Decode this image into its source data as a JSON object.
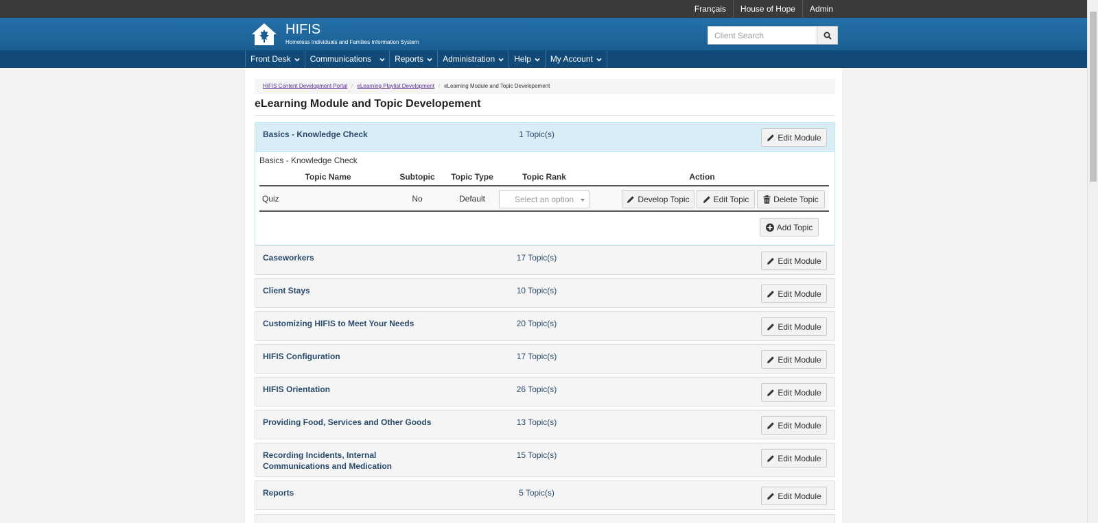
{
  "topbar": {
    "language": "Français",
    "organization": "House of Hope",
    "user": "Admin"
  },
  "header": {
    "app_name": "HIFIS",
    "app_subtitle": "Homeless Individuals and Families Information System",
    "search_placeholder": "Client Search"
  },
  "nav": [
    {
      "label": "Front Desk"
    },
    {
      "label": "Communications"
    },
    {
      "label": "Reports"
    },
    {
      "label": "Administration"
    },
    {
      "label": "Help"
    },
    {
      "label": "My Account"
    }
  ],
  "breadcrumb": {
    "items": [
      "HIFIS Content Development Portal",
      "eLearning Playlist Development"
    ],
    "current": "eLearning Module and Topic Developement"
  },
  "page_title": "eLearning Module and Topic Developement",
  "edit_module_label": "Edit Module",
  "open_module": {
    "name": "Basics - Knowledge Check",
    "count": "1 Topic(s)",
    "body_title": "Basics - Knowledge Check",
    "columns": [
      "Topic Name",
      "Subtopic",
      "Topic Type",
      "Topic Rank",
      "Action"
    ],
    "rows": [
      {
        "name": "Quiz",
        "subtopic": "No",
        "type": "Default",
        "rank_placeholder": "Select an option",
        "develop_label": "Develop Topic",
        "edit_label": "Edit Topic",
        "delete_label": "Delete Topic"
      }
    ],
    "add_topic_label": "Add Topic"
  },
  "modules": [
    {
      "name": "Caseworkers",
      "count": "17 Topic(s)"
    },
    {
      "name": "Client Stays",
      "count": "10 Topic(s)"
    },
    {
      "name": "Customizing HIFIS to Meet Your Needs",
      "count": "20 Topic(s)"
    },
    {
      "name": "HIFIS Configuration",
      "count": "17 Topic(s)"
    },
    {
      "name": "HIFIS Orientation",
      "count": "26 Topic(s)"
    },
    {
      "name": "Providing Food, Services and Other Goods",
      "count": "13 Topic(s)"
    },
    {
      "name": "Recording Incidents, Internal Communications and Medication",
      "count": "15 Topic(s)"
    },
    {
      "name": "Reports",
      "count": "5 Topic(s)"
    }
  ],
  "colors": {
    "topbar": "#3a3a3a",
    "header": "#1a5f93",
    "nav": "#124a77",
    "open_module_header": "#d9edf7",
    "module_text": "#2a4a6b",
    "breadcrumb_link": "#5a2d91"
  }
}
